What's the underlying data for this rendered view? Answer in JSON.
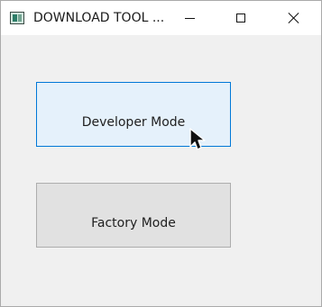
{
  "window": {
    "title": "DOWNLOAD TOOL ...",
    "icon": "app-window-icon",
    "controls": {
      "minimize_icon": "minimize-icon",
      "maximize_icon": "maximize-icon",
      "close_icon": "close-icon"
    }
  },
  "buttons": {
    "developer_mode": "Developer Mode",
    "factory_mode": "Factory Mode"
  },
  "colors": {
    "window_background": "#f0f0f0",
    "titlebar_background": "#ffffff",
    "developer_button_background": "#e5f1fb",
    "developer_button_border": "#0078d7",
    "factory_button_background": "#e1e1e1",
    "factory_button_border": "#adadad"
  },
  "cursor": {
    "icon": "mouse-pointer-icon"
  }
}
